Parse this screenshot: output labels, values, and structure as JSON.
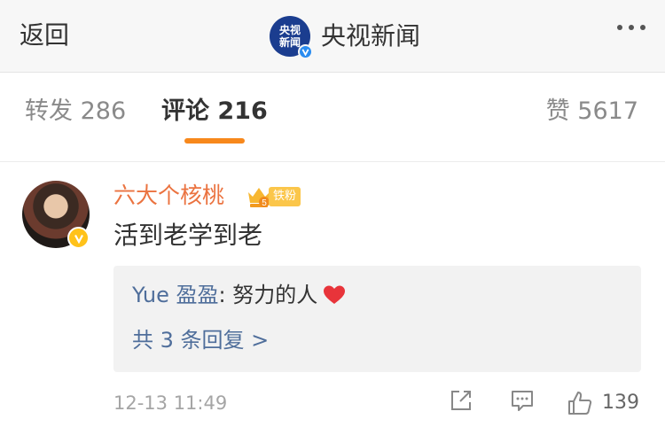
{
  "nav": {
    "back_label": "返回",
    "logo_text_top": "央视",
    "logo_text_bottom": "新闻",
    "title": "央视新闻",
    "more_icon": "more-icon"
  },
  "tabs": {
    "repost": "转发 286",
    "comment": "评论 216",
    "like": "赞 5617",
    "active": "comment",
    "accent_color": "#f7881c"
  },
  "comment": {
    "username": "六大个核桃",
    "username_color": "#eb7340",
    "crown_level": "5",
    "fan_badge": "铁粉",
    "text": "活到老学到老",
    "reply": {
      "user": "Yue 盈盈",
      "text": ": 努力的人",
      "count_label": "共 3 条回复 >"
    },
    "timestamp": "12-13 11:49",
    "like_count": "139"
  }
}
